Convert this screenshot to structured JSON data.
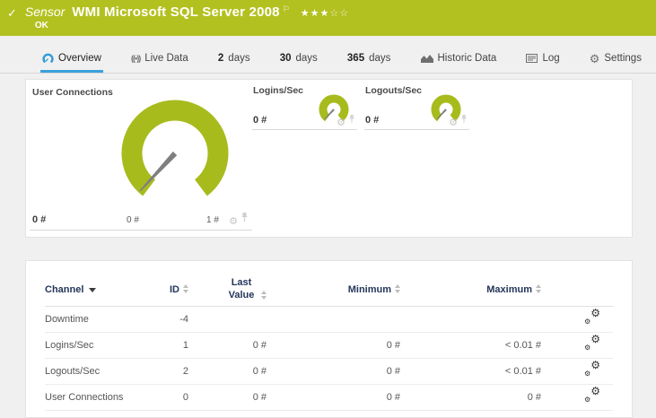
{
  "colors": {
    "header-bg": "#b3c120",
    "gauge-green": "#a8bb1d",
    "tab-blue": "#3aa2db",
    "navy": "#24365a",
    "needle": "#7f7f7f"
  },
  "header": {
    "check_icon": "✓",
    "kind": "Sensor",
    "title": "WMI Microsoft SQL Server 2008",
    "flag_icon": "⚐",
    "stars_filled": "★★★",
    "stars_empty": "☆☆",
    "status": "OK"
  },
  "tabs": {
    "overview": "Overview",
    "live_data": "Live Data",
    "d2_num": "2",
    "d2_label": "days",
    "d30_num": "30",
    "d30_label": "days",
    "d365_num": "365",
    "d365_label": "days",
    "historic": "Historic Data",
    "log": "Log",
    "settings": "Settings"
  },
  "icons": {
    "gear": "⚙",
    "live": "((•))"
  },
  "gauges": {
    "main": {
      "title": "User Connections",
      "value": "0 #",
      "scale_min": "0 #",
      "scale_max": "1 #"
    },
    "small": [
      {
        "title": "Logins/Sec",
        "value": "0 #"
      },
      {
        "title": "Logouts/Sec",
        "value": "0 #"
      }
    ]
  },
  "table": {
    "headers": {
      "channel": "Channel",
      "id": "ID",
      "last_value": "Last Value",
      "minimum": "Minimum",
      "maximum": "Maximum"
    },
    "rows": [
      {
        "channel": "Downtime",
        "id": "-4",
        "last": "",
        "min": "",
        "max": ""
      },
      {
        "channel": "Logins/Sec",
        "id": "1",
        "last": "0 #",
        "min": "0 #",
        "max": "< 0.01 #"
      },
      {
        "channel": "Logouts/Sec",
        "id": "2",
        "last": "0 #",
        "min": "0 #",
        "max": "< 0.01 #"
      },
      {
        "channel": "User Connections",
        "id": "0",
        "last": "0 #",
        "min": "0 #",
        "max": "0 #"
      }
    ]
  }
}
